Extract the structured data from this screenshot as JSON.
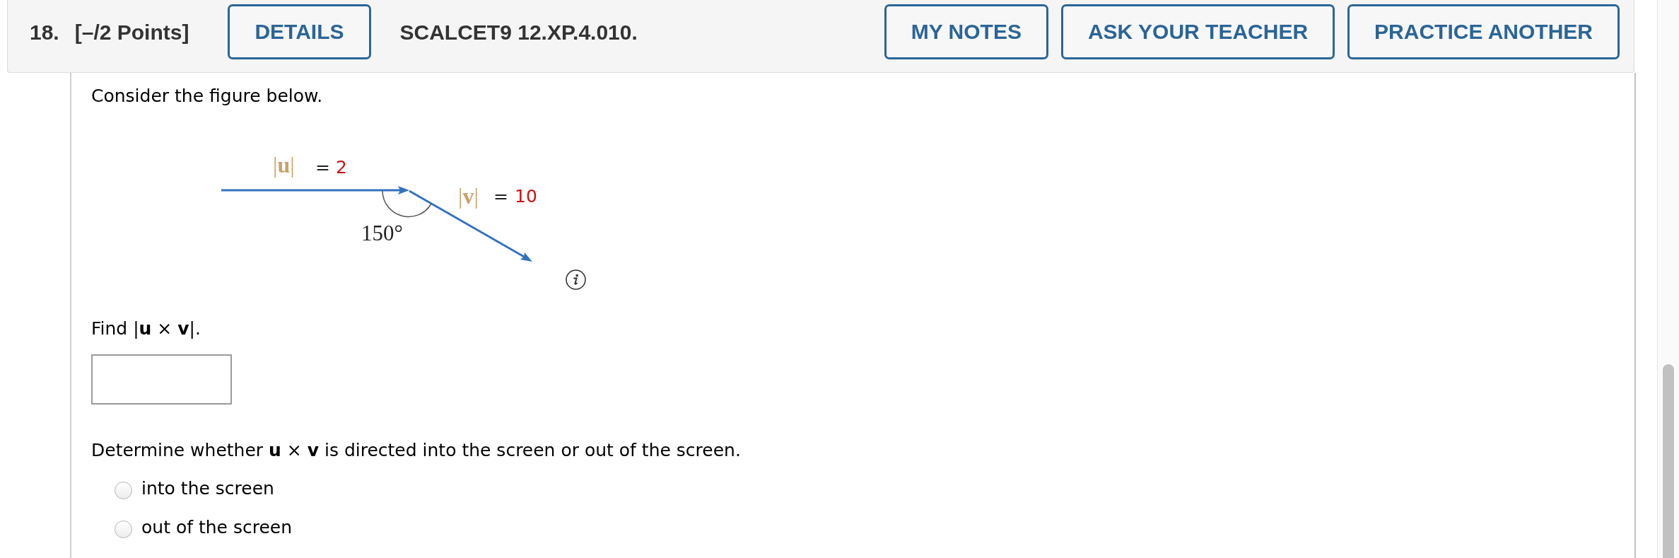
{
  "question": {
    "number": "18.",
    "points": "[–/2 Points]",
    "details_button": "DETAILS",
    "code": "SCALCET9 12.XP.4.010.",
    "actions": [
      {
        "label": "MY NOTES"
      },
      {
        "label": "ASK YOUR TEACHER"
      },
      {
        "label": "PRACTICE ANOTHER"
      }
    ]
  },
  "body": {
    "intro": "Consider the figure below.",
    "figure": {
      "vectors": [
        {
          "norm": "|**u**|",
          "equals": "=",
          "magnitude": "2"
        },
        {
          "norm": "|**v**|",
          "equals": "=",
          "magnitude": "10"
        }
      ],
      "angle": "150°"
    },
    "prompt_1": "Find |**u** × **v**|.",
    "prompt_2": "Determine whether **u** × **v** is directed into the screen or out of the screen.",
    "options": [
      {
        "label": "into the screen",
        "selected": false
      },
      {
        "label": "out of the screen",
        "selected": false
      }
    ]
  }
}
